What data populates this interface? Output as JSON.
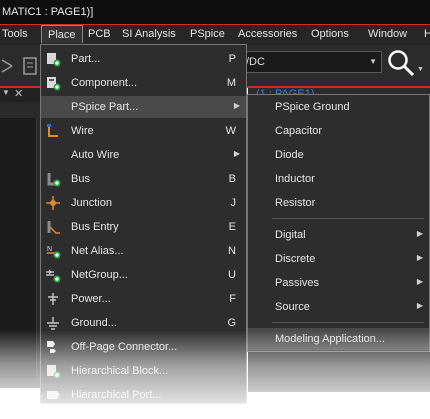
{
  "window": {
    "title": "MATIC1 : PAGE1)]"
  },
  "menubar": {
    "items": [
      {
        "label": "Tools"
      },
      {
        "label": "Place"
      },
      {
        "label": "PCB"
      },
      {
        "label": "SI Analysis"
      },
      {
        "label": "PSpice"
      },
      {
        "label": "Accessories"
      },
      {
        "label": "Options"
      },
      {
        "label": "Window"
      },
      {
        "label": "H"
      }
    ],
    "active": "Place"
  },
  "toolbar": {
    "combo_value": "/DC"
  },
  "document_tab": {
    "label": "(1 : PAGE1)"
  },
  "place_menu": {
    "items": [
      {
        "label": "Part...",
        "shortcut": "P",
        "icon": "part-icon"
      },
      {
        "label": "Component...",
        "shortcut": "M",
        "icon": "component-icon"
      },
      {
        "label": "PSpice Part...",
        "shortcut": "",
        "icon": "",
        "submenu": true,
        "highlighted": true
      },
      {
        "label": "Wire",
        "shortcut": "W",
        "icon": "wire-icon"
      },
      {
        "label": "Auto Wire",
        "shortcut": "",
        "icon": "",
        "submenu": true
      },
      {
        "label": "Bus",
        "shortcut": "B",
        "icon": "bus-icon"
      },
      {
        "label": "Junction",
        "shortcut": "J",
        "icon": "junction-icon"
      },
      {
        "label": "Bus Entry",
        "shortcut": "E",
        "icon": "bus-entry-icon"
      },
      {
        "label": "Net Alias...",
        "shortcut": "N",
        "icon": "net-alias-icon"
      },
      {
        "label": "NetGroup...",
        "shortcut": "U",
        "icon": "netgroup-icon"
      },
      {
        "label": "Power...",
        "shortcut": "F",
        "icon": "power-icon"
      },
      {
        "label": "Ground...",
        "shortcut": "G",
        "icon": "ground-icon"
      },
      {
        "label": "Off-Page Connector...",
        "shortcut": "",
        "icon": "off-page-connector-icon"
      },
      {
        "label": "Hierarchical Block...",
        "shortcut": "",
        "icon": "hierarchical-block-icon"
      },
      {
        "label": "Hierarchical Port...",
        "shortcut": "",
        "icon": "hierarchical-port-icon"
      }
    ]
  },
  "pspice_submenu": {
    "items": [
      {
        "label": "PSpice Ground"
      },
      {
        "label": "Capacitor"
      },
      {
        "label": "Diode"
      },
      {
        "label": "Inductor"
      },
      {
        "label": "Resistor"
      },
      {
        "label": "Digital",
        "submenu": true
      },
      {
        "label": "Discrete",
        "submenu": true
      },
      {
        "label": "Passives",
        "submenu": true
      },
      {
        "label": "Source",
        "submenu": true
      },
      {
        "label": "Modeling Application...",
        "highlighted": true
      }
    ]
  },
  "colors": {
    "menu_bg": "#2d2d2d",
    "highlight": "#4a4a4a",
    "accent_red": "#c42d28",
    "icon_green": "#2fa84f"
  }
}
